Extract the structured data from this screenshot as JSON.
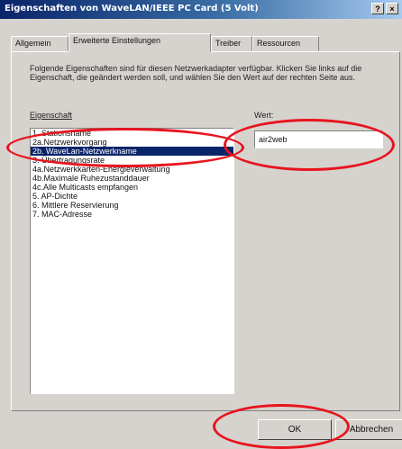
{
  "window": {
    "title": "Eigenschaften von WaveLAN/IEEE PC Card (5 Volt)",
    "help_button": "?",
    "close_button": "×"
  },
  "tabs": [
    {
      "label": "Allgemein"
    },
    {
      "label": "Erweiterte Einstellungen",
      "active": true
    },
    {
      "label": "Treiber"
    },
    {
      "label": "Ressourcen"
    }
  ],
  "description": "Folgende Eigenschaften sind für diesen Netzwerkadapter verfügbar. Klicken Sie links auf die Eigenschaft, die geändert werden soll, und wählen Sie den Wert auf der rechten Seite aus.",
  "property_label": "Eigenschaft",
  "value_label": "Wert:",
  "properties": [
    {
      "label": "1. Stationsname"
    },
    {
      "label": "2a.Netzwerkvorgang"
    },
    {
      "label": "2b. WaveLan-Netzwerkname",
      "selected": true
    },
    {
      "label": "3. Übertragungsrate"
    },
    {
      "label": "4a.Netzwerkkarten-Energieverwaltung"
    },
    {
      "label": "4b.Maximale Ruhezustanddauer"
    },
    {
      "label": "4c.Alle Multicasts empfangen"
    },
    {
      "label": "5. AP-Dichte"
    },
    {
      "label": "6. Mittlere Reservierung"
    },
    {
      "label": "7. MAC-Adresse"
    }
  ],
  "value": "air2web",
  "buttons": {
    "ok": "OK",
    "cancel": "Abbrechen"
  },
  "annotation_color": "#e8141e"
}
